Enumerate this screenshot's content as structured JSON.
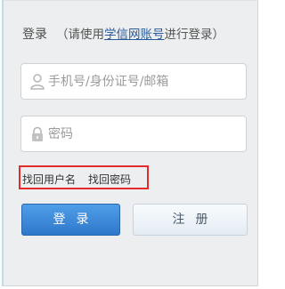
{
  "header": {
    "title": "登录",
    "hint_open": "（请使用",
    "hint_link": "学信网账号",
    "hint_close": "进行登录）"
  },
  "username_field": {
    "icon": "user-icon",
    "placeholder": "手机号/身份证号/邮箱"
  },
  "password_field": {
    "icon": "lock-icon",
    "placeholder": "密码"
  },
  "recovery_links": {
    "find_username": "找回用户名",
    "find_password": "找回密码",
    "highlight_color": "#e32b2b"
  },
  "buttons": {
    "login": "登录",
    "register": "注册"
  },
  "colors": {
    "login_button": "#3a86d6",
    "link": "#2a5a9a"
  }
}
